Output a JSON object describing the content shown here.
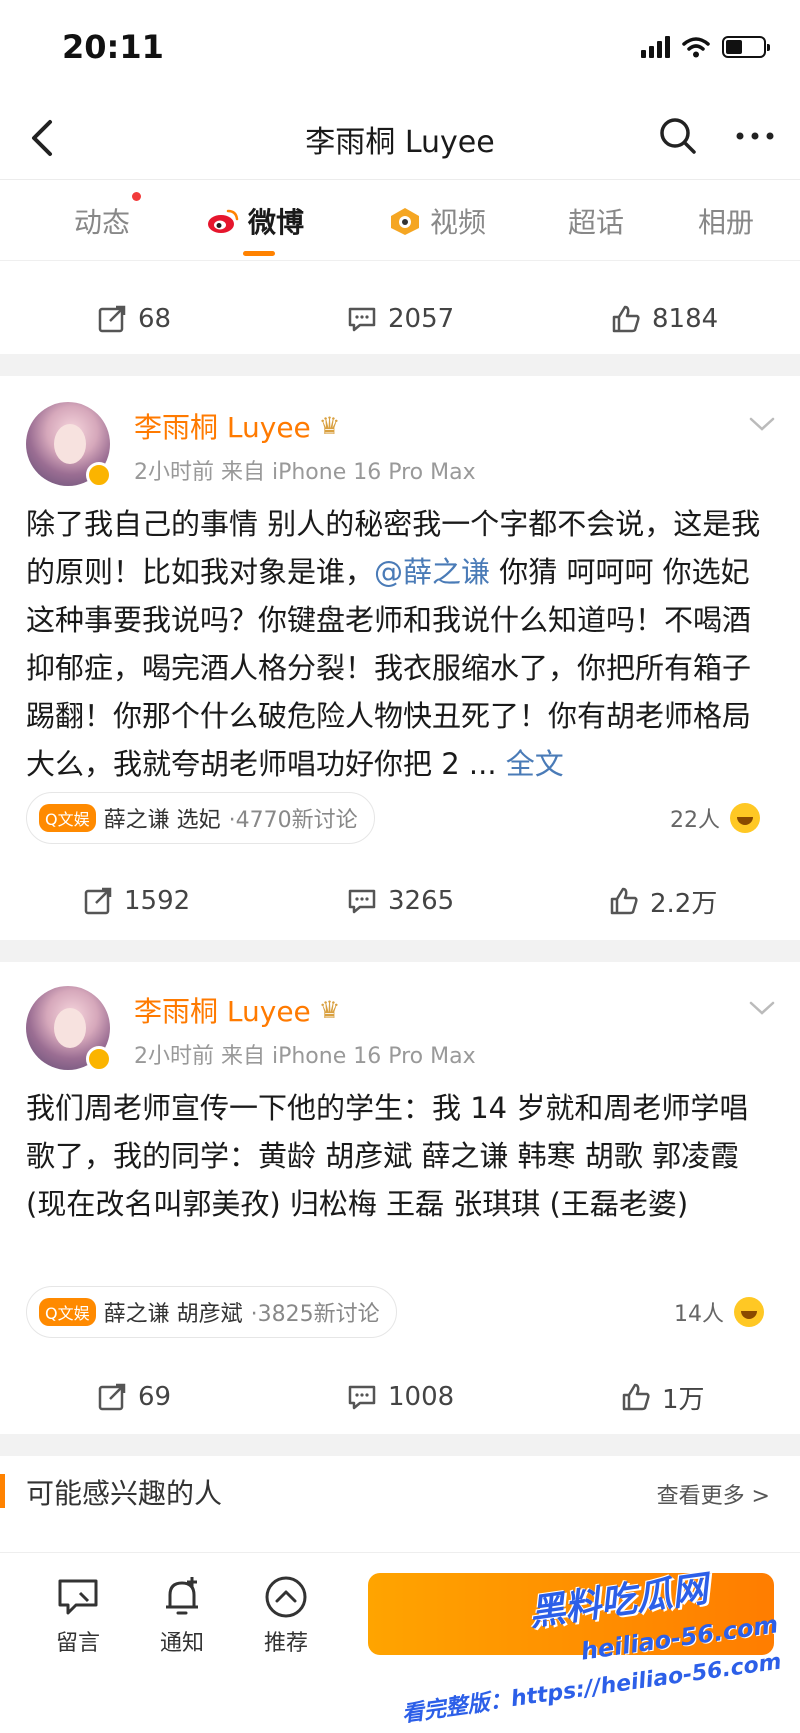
{
  "status_bar": {
    "time": "20:11"
  },
  "nav": {
    "title": "李雨桐 Luyee"
  },
  "tabs": [
    {
      "label": "动态"
    },
    {
      "label": "微博"
    },
    {
      "label": "视频"
    },
    {
      "label": "超话"
    },
    {
      "label": "相册"
    }
  ],
  "top_actions": {
    "repost": "68",
    "comment": "2057",
    "like": "8184"
  },
  "posts": [
    {
      "author": "李雨桐 Luyee",
      "meta": "2小时前  来自 iPhone 16 Pro Max",
      "text_before": "除了我自己的事情 别人的秘密我一个字都不会说，这是我的原则！比如我对象是谁，",
      "mention": "@薛之谦",
      "text_after": " 你猜 呵呵呵 你选妃这种事要我说吗？你键盘老师和我说什么知道吗！不喝酒抑郁症，喝完酒人格分裂！我衣服缩水了，你把所有箱子踢翻！你那个什么破危险人物快丑死了！你有胡老师格局大么，我就夸胡老师唱功好你把 2 ... ",
      "more_label": "全文",
      "topic_tag": "Q文娱",
      "topic_text": "薛之谦 选妃",
      "topic_count": "·4770新讨论",
      "people": "22人",
      "actions": {
        "repost": "1592",
        "comment": "3265",
        "like": "2.2万"
      }
    },
    {
      "author": "李雨桐 Luyee",
      "meta": "2小时前  来自 iPhone 16 Pro Max",
      "text": "我们周老师宣传一下他的学生：我 14 岁就和周老师学唱歌了，我的同学：黄龄 胡彦斌 薛之谦 韩寒 胡歌 郭凌霞 (现在改名叫郭美孜) 归松梅 王磊 张琪琪 (王磊老婆)",
      "topic_tag": "Q文娱",
      "topic_text": "薛之谦 胡彦斌",
      "topic_count": "·3825新讨论",
      "people": "14人",
      "actions": {
        "repost": "69",
        "comment": "1008",
        "like": "1万"
      }
    }
  ],
  "recommend": {
    "title": "可能感兴趣的人",
    "more": "查看更多 >"
  },
  "bottom_bar": {
    "message": "留言",
    "notify": "通知",
    "recommend": "推荐"
  },
  "watermark": {
    "brand": "黑料吃瓜网",
    "url": "heiliao-56.com",
    "sub": "看完整版：https://heiliao-56.com"
  },
  "colors": {
    "accent": "#ff8200",
    "link": "#4a7bb7",
    "author": "#ff7a00"
  }
}
